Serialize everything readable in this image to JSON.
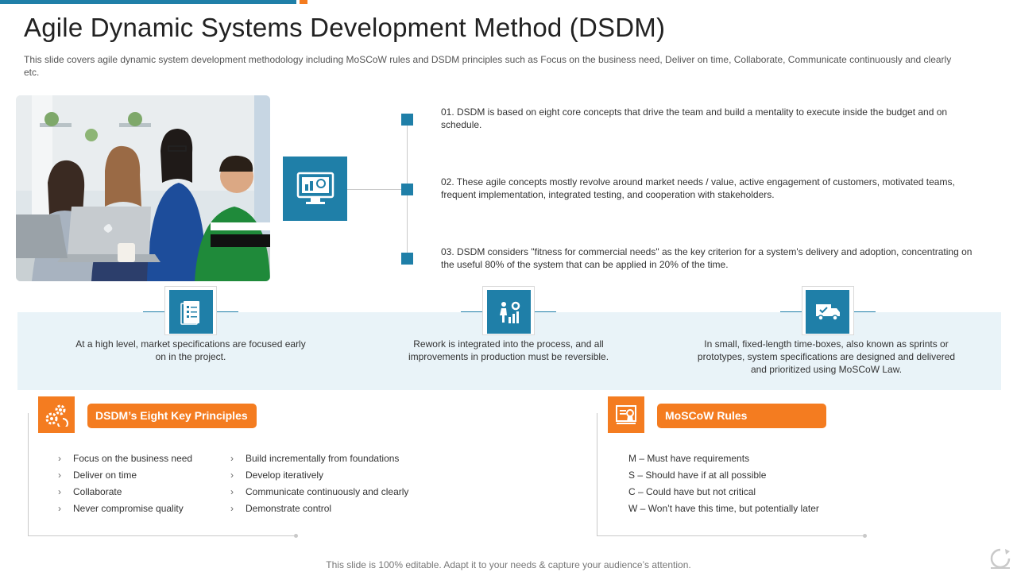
{
  "slide": {
    "title": "Agile Dynamic Systems Development Method (DSDM)",
    "subtitle": "This slide covers agile dynamic system development  methodology including MoSCoW rules and DSDM principles such as Focus on the business need, Deliver  on time, Collaborate, Communicate continuously and clearly etc.",
    "footer": "This slide is 100% editable. Adapt it to your needs & capture your audience’s attention."
  },
  "points": [
    "01.  DSDM is based on eight core concepts that drive  the team and build a mentality to execute inside the budget and on schedule.",
    "02.  These agile concepts mostly revolve  around market needs / value,  active engagement  of customers, motivated teams, frequent  implementation, integrated testing, and cooperation with stakeholders.",
    "03.  DSDM considers \"fitness for commercial needs\" as the key criterion for a system's delivery  and adoption, concentrating on the useful 80% of the system that can be applied in 20% of the time."
  ],
  "features": [
    "At a high level, market specifications are focused early on in the project.",
    "Rework is integrated into the process, and all improvements in production must be reversible.",
    "In small, fixed-length time-boxes, also known as sprints or prototypes, system specifications are designed and delivered  and prioritized using MoSCoW Law."
  ],
  "principles": {
    "heading": "DSDM’s Eight Key Principles",
    "col1": [
      "Focus on the business need",
      "Deliver on time",
      "Collaborate",
      "Never compromise quality"
    ],
    "col2": [
      "Build incrementally from foundations",
      "Develop iteratively",
      "Communicate continuously and clearly",
      "Demonstrate control"
    ],
    "bullet": "›"
  },
  "moscow": {
    "heading": "MoSCoW Rules",
    "rules": [
      "M – Must have requirements",
      "S – Should have if at all possible",
      "C – Could have but not critical",
      "W – Won’t have this time, but potentially later"
    ]
  },
  "colors": {
    "accent_blue": "#1f7fa8",
    "accent_orange": "#f47c20",
    "band": "#e9f3f8"
  },
  "icons": [
    "monitor-gear-icon",
    "document-checklist-icon",
    "worker-gear-chart-icon",
    "delivery-truck-icon",
    "gears-icon",
    "certificate-icon",
    "refresh-logo-icon"
  ]
}
